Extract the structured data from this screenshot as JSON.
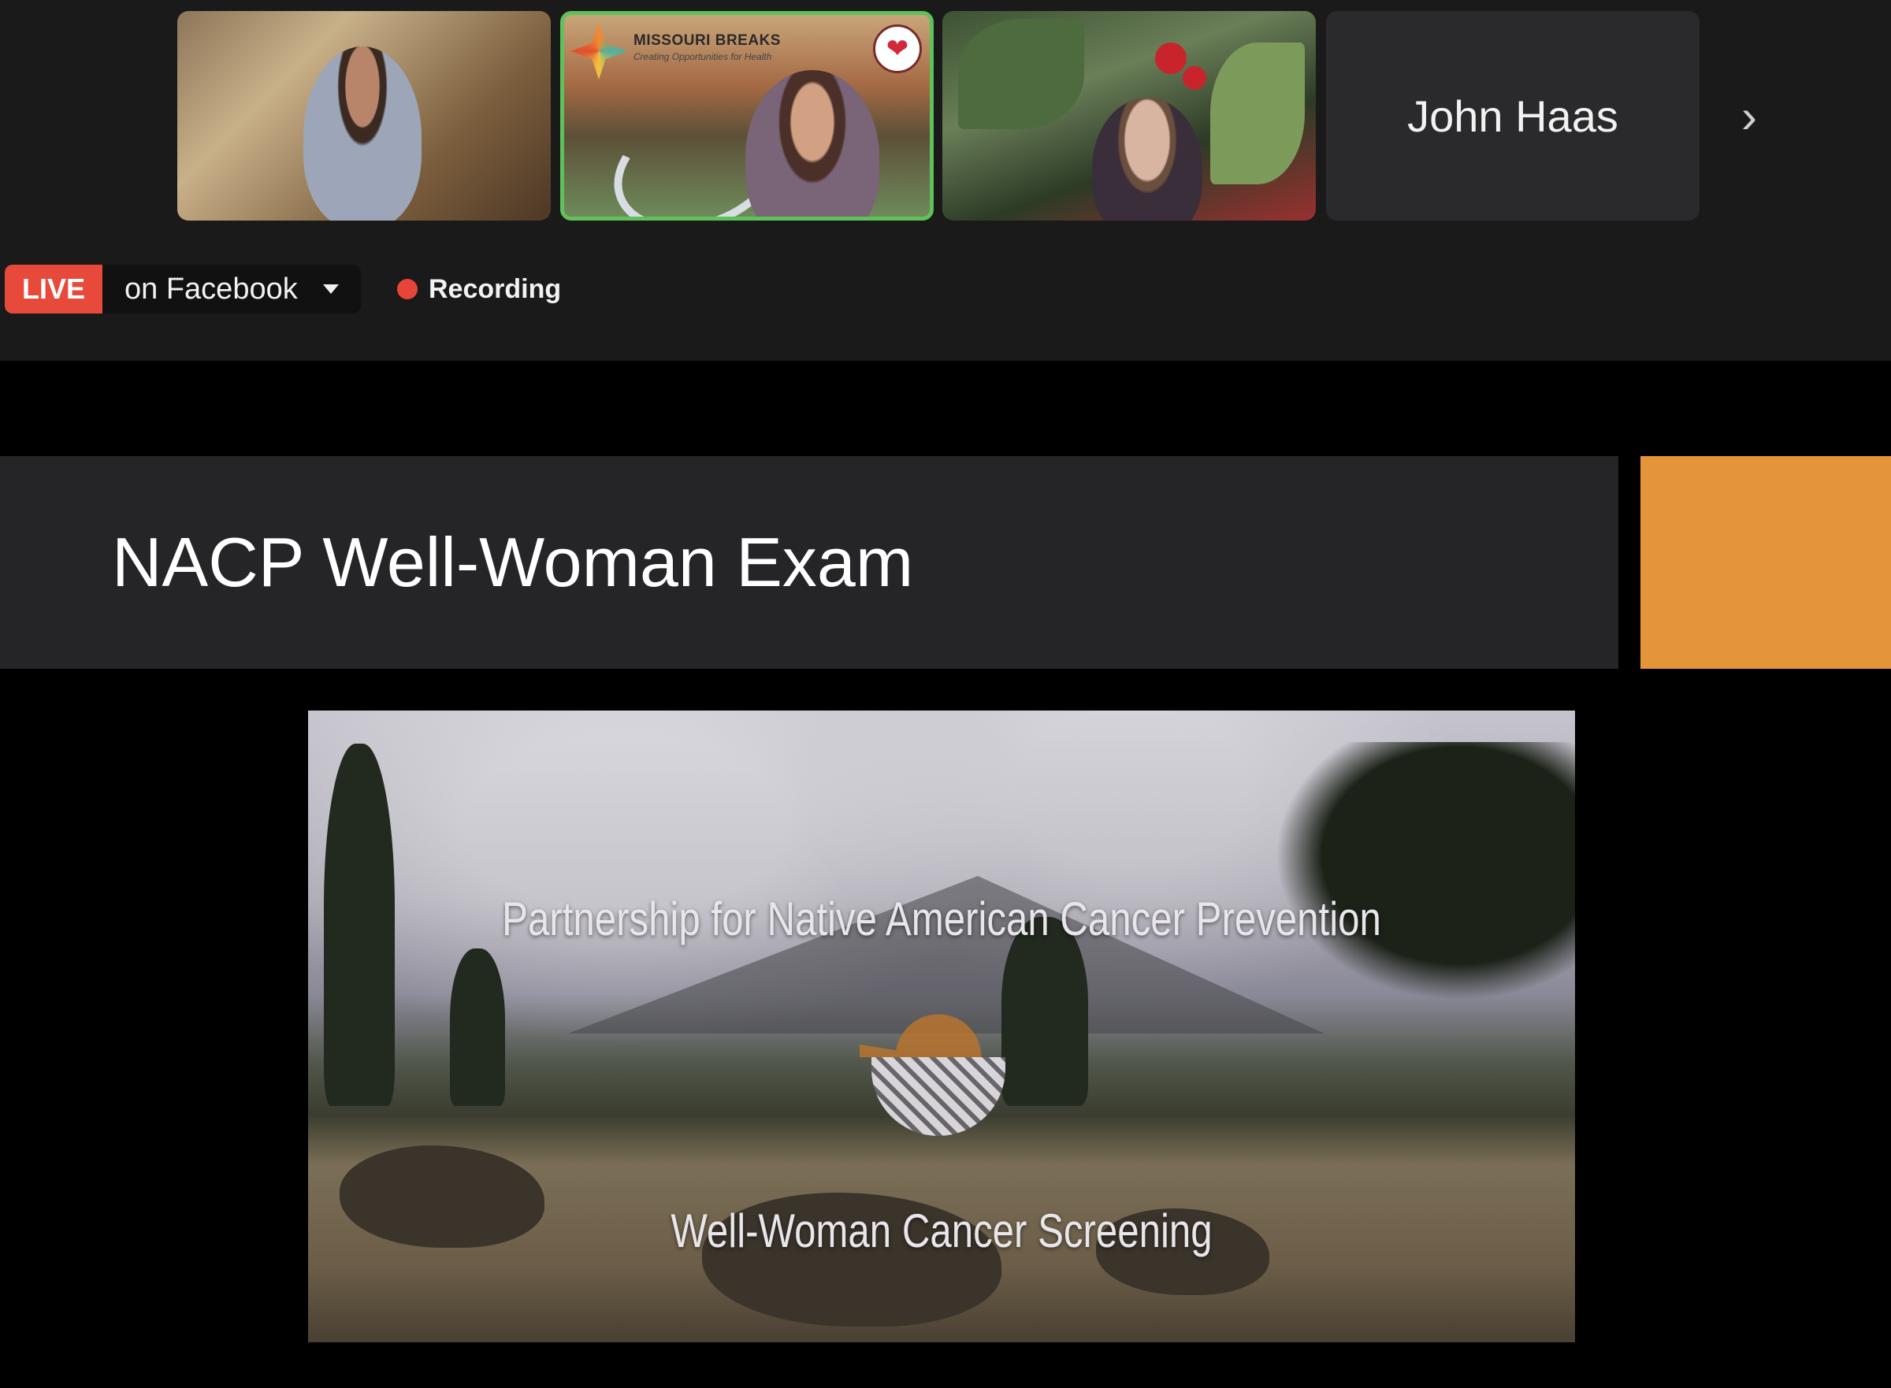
{
  "participants": [
    {
      "id": "p1",
      "name": ""
    },
    {
      "id": "p2",
      "name": "",
      "background_brand": "MISSOURI BREAKS",
      "background_tagline": "Creating Opportunities for Health"
    },
    {
      "id": "p3",
      "name": ""
    },
    {
      "id": "p4",
      "name": "John Haas"
    }
  ],
  "active_speaker_border_color": "#5ec15a",
  "livestream": {
    "badge": "LIVE",
    "target": "on Facebook",
    "badge_color": "#e74a3b"
  },
  "recording": {
    "label": "Recording",
    "dot_color": "#e8453a"
  },
  "slide": {
    "title": "NACP Well-Woman Exam",
    "accent_color": "#e4953a",
    "video_line1": "Partnership for Native American Cancer Prevention",
    "video_line2": "Well-Woman Cancer Screening"
  },
  "icons": {
    "next": "chevron-right-icon",
    "dropdown": "caret-down-icon",
    "recording": "record-dot-icon"
  }
}
